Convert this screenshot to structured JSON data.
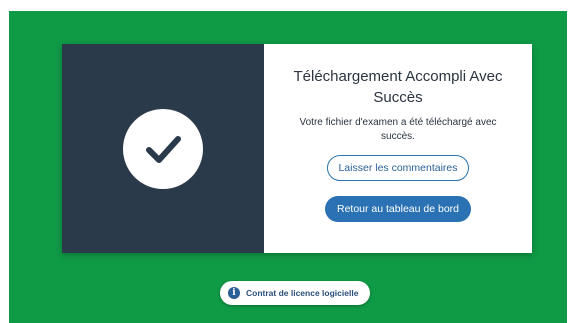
{
  "colors": {
    "background": "#0f9a46",
    "panel_dark": "#2b3a4b",
    "accent": "#2a72b3",
    "text": "#2b3440"
  },
  "card": {
    "icon": "checkmark-icon",
    "title": "Téléchargement Accompli Avec Succès",
    "message": "Votre fichier d'examen a été téléchargé avec succès.",
    "feedback_button_label": "Laisser les commentaires",
    "dashboard_button_label": "Retour au tableau de bord"
  },
  "footer": {
    "icon": "info-icon",
    "license_label": "Contrat de licence logicielle"
  }
}
